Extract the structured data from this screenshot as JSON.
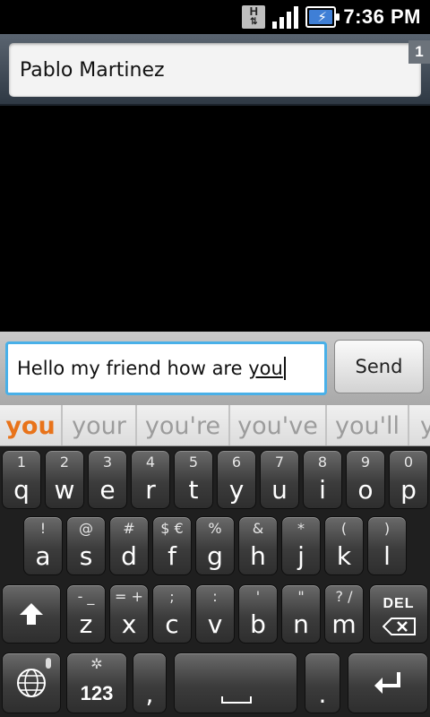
{
  "status_bar": {
    "network_type": "H",
    "time": "7:36 PM",
    "battery_level": 1.0,
    "signal_level": 4,
    "icons": [
      "hsdpa-data-icon",
      "signal-strength-icon",
      "battery-charging-icon"
    ]
  },
  "recipient": {
    "name": "Pablo Martinez",
    "count": "1"
  },
  "compose": {
    "text_before": "Hello my friend how are ",
    "composing_word": "you",
    "send_label": "Send"
  },
  "suggestions": [
    "you",
    "your",
    "you're",
    "you've",
    "you'll",
    "y"
  ],
  "keyboard": {
    "row1": [
      {
        "alt": "1",
        "main": "q"
      },
      {
        "alt": "2",
        "main": "w"
      },
      {
        "alt": "3",
        "main": "e"
      },
      {
        "alt": "4",
        "main": "r"
      },
      {
        "alt": "5",
        "main": "t"
      },
      {
        "alt": "6",
        "main": "y"
      },
      {
        "alt": "7",
        "main": "u"
      },
      {
        "alt": "8",
        "main": "i"
      },
      {
        "alt": "9",
        "main": "o"
      },
      {
        "alt": "0",
        "main": "p"
      }
    ],
    "row2": [
      {
        "alt": "!",
        "main": "a"
      },
      {
        "alt": "@",
        "main": "s"
      },
      {
        "alt": "#",
        "main": "d"
      },
      {
        "alt": "$ €",
        "main": "f"
      },
      {
        "alt": "%",
        "main": "g"
      },
      {
        "alt": "&",
        "main": "h"
      },
      {
        "alt": "*",
        "main": "j"
      },
      {
        "alt": "(",
        "main": "k"
      },
      {
        "alt": ")",
        "main": "l"
      }
    ],
    "row3": [
      {
        "alt": "- _",
        "main": "z"
      },
      {
        "alt": "= +",
        "main": "x"
      },
      {
        "alt": ";",
        "main": "c"
      },
      {
        "alt": ":",
        "main": "v"
      },
      {
        "alt": "'",
        "main": "b"
      },
      {
        "alt": "\"",
        "main": "n"
      },
      {
        "alt": "? /",
        "main": "m"
      }
    ],
    "del_label": "DEL",
    "symbols_label": "123",
    "comma_label": ",",
    "period_label": ".",
    "icons": {
      "shift": "shift-arrow-icon",
      "backspace": "backspace-icon",
      "language": "globe-icon",
      "mic": "microphone-icon",
      "settings": "gear-icon",
      "space": "space-bar-icon",
      "enter": "enter-arrow-icon"
    }
  },
  "colors": {
    "compose_focus_border": "#49b0e8",
    "primary_suggestion": "#e8731a",
    "battery_fill": "#3f7fd6"
  }
}
